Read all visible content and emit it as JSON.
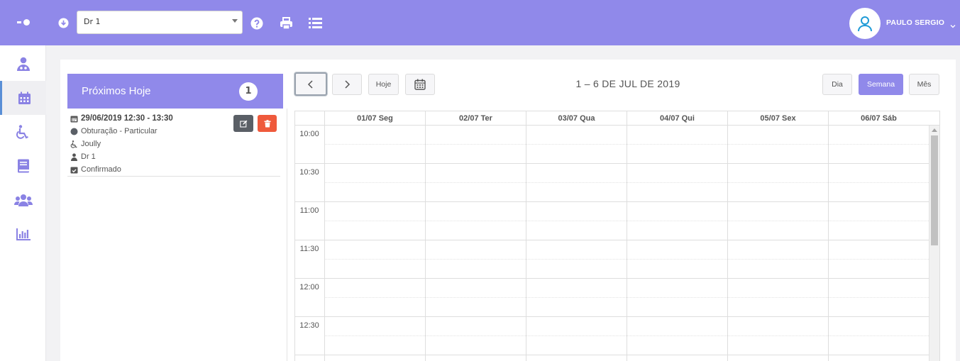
{
  "colors": {
    "accent": "#9089ea",
    "danger": "#ef5a3c",
    "dark_button": "#5a5f66",
    "active_nav_border": "#5a8fd6"
  },
  "header": {
    "doctor_select": {
      "value": "Dr 1"
    },
    "user_name": "PAULO SERGIO"
  },
  "sidebar": {
    "items": [
      {
        "icon": "user-md-icon",
        "active": false
      },
      {
        "icon": "calendar-icon",
        "active": true
      },
      {
        "icon": "wheelchair-icon",
        "active": false
      },
      {
        "icon": "book-icon",
        "active": false
      },
      {
        "icon": "users-icon",
        "active": false
      },
      {
        "icon": "bar-chart-icon",
        "active": false
      }
    ]
  },
  "upcoming": {
    "title": "Próximos Hoje",
    "count": "1",
    "appointment": {
      "datetime": "29/06/2019 12:30 - 13:30",
      "procedure": "Obturação - Particular",
      "patient": "Joully",
      "doctor": "Dr 1",
      "status": "Confirmado"
    }
  },
  "calendar": {
    "today_label": "Hoje",
    "range_title": "1 – 6 DE JUL DE 2019",
    "views": {
      "day": "Dia",
      "week": "Semana",
      "month": "Mês"
    },
    "active_view": "Semana",
    "days": [
      "01/07 Seg",
      "02/07 Ter",
      "03/07 Qua",
      "04/07 Qui",
      "05/07 Sex",
      "06/07 Sáb"
    ],
    "times": [
      "10:00",
      "10:30",
      "11:00",
      "11:30",
      "12:00",
      "12:30"
    ]
  }
}
